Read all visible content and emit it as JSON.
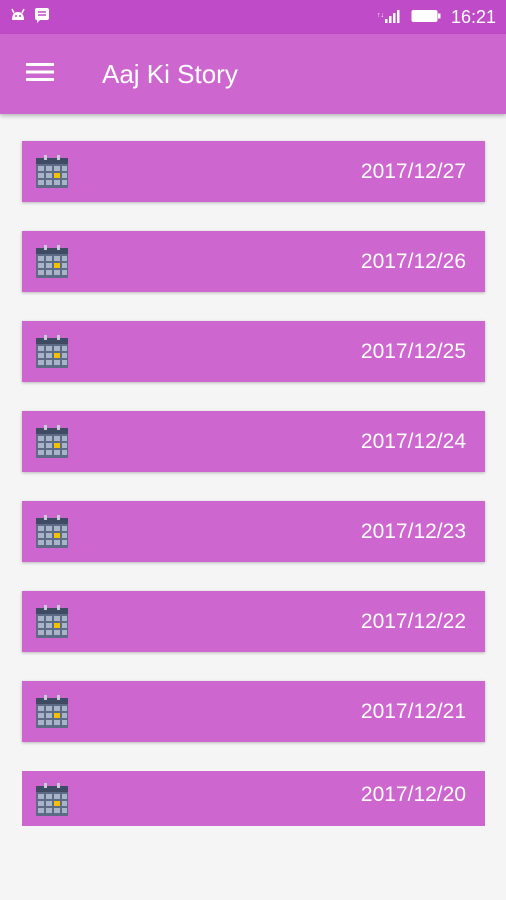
{
  "status_bar": {
    "time": "16:21",
    "icons": [
      "android-notification-icon",
      "message-notification-icon",
      "signal-icon",
      "battery-icon"
    ]
  },
  "app_bar": {
    "title": "Aaj Ki Story",
    "menu_icon": "hamburger-menu-icon"
  },
  "stories": [
    {
      "date": "2017/12/27"
    },
    {
      "date": "2017/12/26"
    },
    {
      "date": "2017/12/25"
    },
    {
      "date": "2017/12/24"
    },
    {
      "date": "2017/12/23"
    },
    {
      "date": "2017/12/22"
    },
    {
      "date": "2017/12/21"
    },
    {
      "date": "2017/12/20"
    }
  ],
  "colors": {
    "status_bar": "#c04bc8",
    "app_bar": "#cd67cf",
    "item_background": "#cd67cf",
    "page_background": "#f5f5f5",
    "text": "#ffffff"
  }
}
